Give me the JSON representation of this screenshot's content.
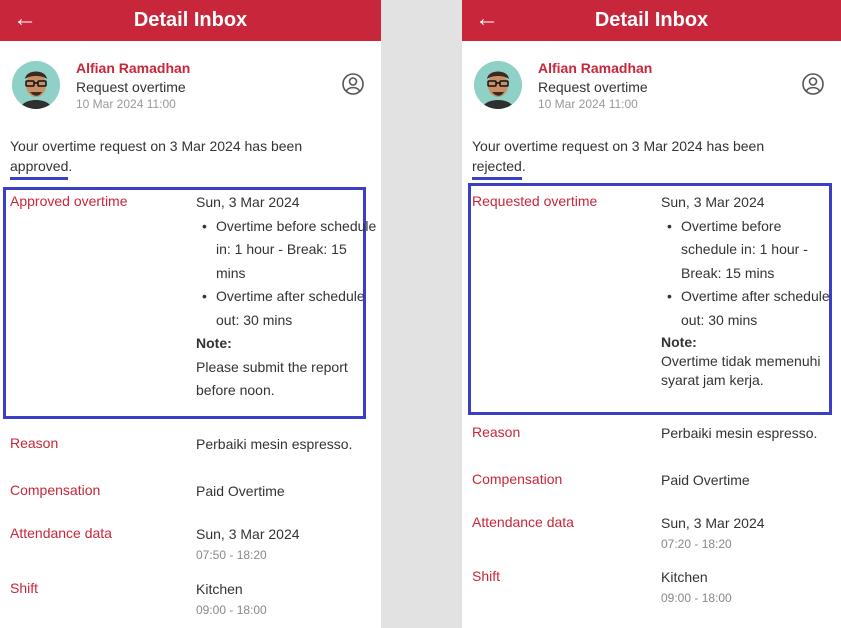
{
  "left": {
    "header_title": "Detail Inbox",
    "sender_name": "Alfian Ramadhan",
    "subject": "Request overtime",
    "time": "10 Mar 2024 11:00",
    "message_prefix": "Your overtime request on 3 Mar 2024 has been",
    "status_word": "approved",
    "message_suffix": ".",
    "overtime": {
      "label": "Approved overtime",
      "date": "Sun, 3 Mar 2024",
      "items": [
        "Overtime before schedule in: 1 hour - Break: 15 mins",
        "Overtime after schedule out: 30 mins"
      ],
      "note_label": "Note:",
      "note_text": "Please submit the report before noon."
    },
    "reason": {
      "label": "Reason",
      "value": "Perbaiki mesin espresso."
    },
    "compensation": {
      "label": "Compensation",
      "value": "Paid Overtime"
    },
    "attendance": {
      "label": "Attendance data",
      "value": "Sun, 3 Mar 2024",
      "sub": "07:50 - 18:20"
    },
    "shift": {
      "label": "Shift",
      "value": "Kitchen",
      "sub": "09:00 - 18:00"
    }
  },
  "right": {
    "header_title": "Detail Inbox",
    "sender_name": "Alfian Ramadhan",
    "subject": "Request overtime",
    "time": "10 Mar 2024 11:00",
    "message_prefix": "Your overtime request on 3 Mar 2024 has been",
    "status_word": "rejected",
    "message_suffix": ".",
    "overtime": {
      "label": "Requested overtime",
      "date": "Sun, 3 Mar 2024",
      "items": [
        "Overtime before schedule in: 1 hour - Break: 15 mins",
        "Overtime after schedule out: 30 mins"
      ],
      "note_label": "Note:",
      "note_text": "Overtime tidak memenuhi syarat jam kerja."
    },
    "reason": {
      "label": "Reason",
      "value": "Perbaiki mesin espresso."
    },
    "compensation": {
      "label": "Compensation",
      "value": "Paid Overtime"
    },
    "attendance": {
      "label": "Attendance data",
      "value": "Sun, 3 Mar 2024",
      "sub": "07:20 - 18:20"
    },
    "shift": {
      "label": "Shift",
      "value": "Kitchen",
      "sub": "09:00 - 18:00"
    }
  },
  "colors": {
    "brand": "#c8263a",
    "highlight": "#3a3fc4",
    "divider_bg": "#e2e2e2"
  },
  "icons": {
    "back": "arrow-left-icon",
    "profile": "user-circle-icon"
  }
}
